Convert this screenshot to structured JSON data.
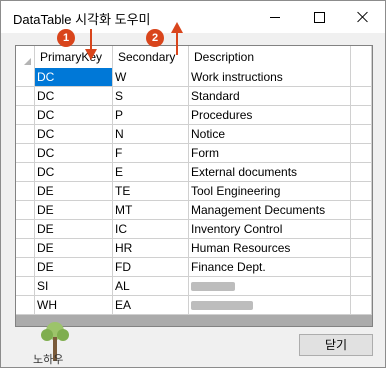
{
  "window": {
    "title": "DataTable 시각화 도우미"
  },
  "columns": [
    "PrimaryKey",
    "Secondary",
    "Description"
  ],
  "rows": [
    {
      "primary": "DC",
      "secondary": "W",
      "description": "Work instructions"
    },
    {
      "primary": "DC",
      "secondary": "S",
      "description": "Standard"
    },
    {
      "primary": "DC",
      "secondary": "P",
      "description": "Procedures"
    },
    {
      "primary": "DC",
      "secondary": "N",
      "description": "Notice"
    },
    {
      "primary": "DC",
      "secondary": "F",
      "description": "Form"
    },
    {
      "primary": "DC",
      "secondary": "E",
      "description": "External documents"
    },
    {
      "primary": "DE",
      "secondary": "TE",
      "description": "Tool Engineering"
    },
    {
      "primary": "DE",
      "secondary": "MT",
      "description": "Management Decuments"
    },
    {
      "primary": "DE",
      "secondary": "IC",
      "description": "Inventory Control"
    },
    {
      "primary": "DE",
      "secondary": "HR",
      "description": "Human Resources"
    },
    {
      "primary": "DE",
      "secondary": "FD",
      "description": "Finance Dept."
    },
    {
      "primary": "SI",
      "secondary": "AL",
      "description": ""
    },
    {
      "primary": "WH",
      "secondary": "EA",
      "description": ""
    }
  ],
  "annotations": [
    "1",
    "2"
  ],
  "buttons": {
    "close_label": "닫기"
  },
  "logo_text": "노하우",
  "colors": {
    "selection": "#0078d7",
    "annotation": "#d9451c",
    "grid_background": "#ababab"
  }
}
